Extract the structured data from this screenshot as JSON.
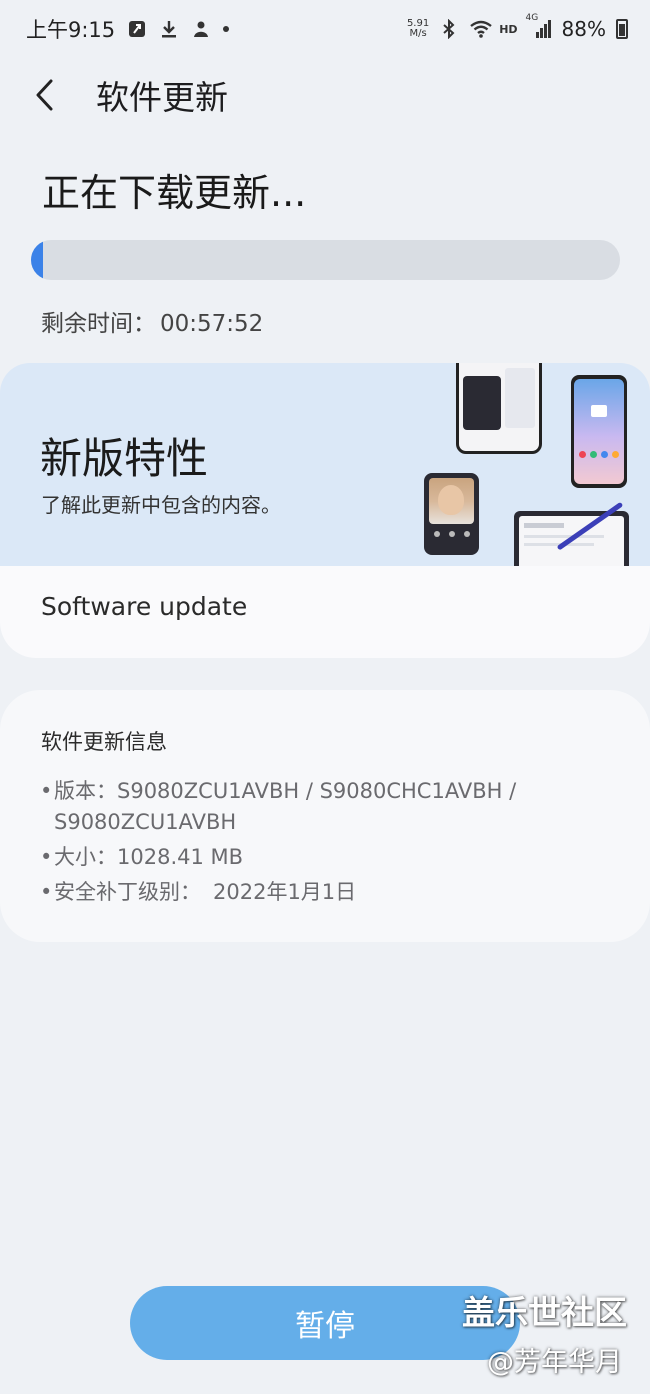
{
  "status_bar": {
    "time": "上午9:15",
    "net_speed_value": "5.91",
    "net_speed_unit": "M/s",
    "hd_label": "HD",
    "network_label": "4G",
    "battery": "88%"
  },
  "header": {
    "title": "软件更新"
  },
  "download": {
    "title": "正在下载更新...",
    "progress_percent": 2,
    "remaining_label": "剩余时间：",
    "remaining_value": "00:57:52"
  },
  "features": {
    "title": "新版特性",
    "subtitle": "了解此更新中包含的内容。",
    "link_label": "Software update"
  },
  "info": {
    "heading": "软件更新信息",
    "items": [
      {
        "label": "版本：",
        "value": "S9080ZCU1AVBH / S9080CHC1AVBH / S9080ZCU1AVBH"
      },
      {
        "label": "大小：",
        "value": "1028.41 MB"
      },
      {
        "label": "安全补丁级别：",
        "value": "2022年1月1日"
      }
    ]
  },
  "actions": {
    "pause_label": "暂停"
  },
  "watermark": {
    "line1": "盖乐世社区",
    "line2": "@芳年华月"
  },
  "colors": {
    "accent": "#3b82e8",
    "pause_button": "#64aee9",
    "banner_bg": "#dbe8f7"
  }
}
